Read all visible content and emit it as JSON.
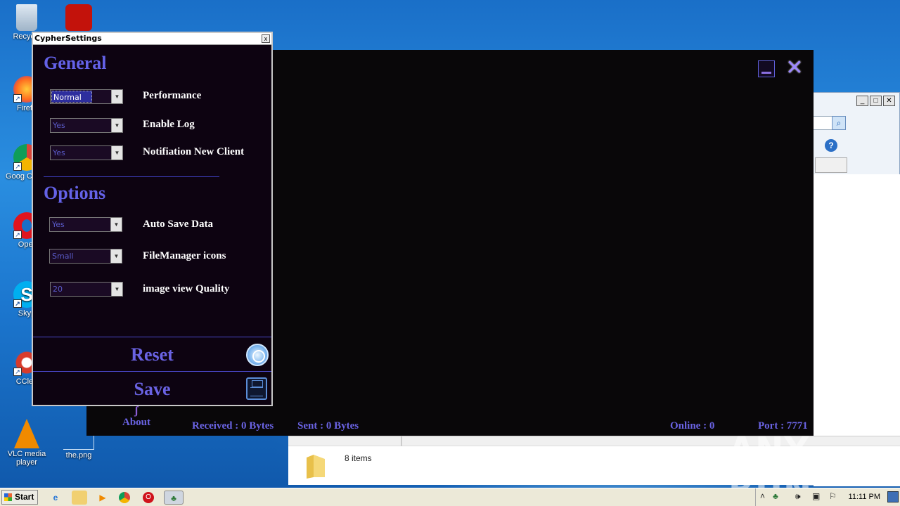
{
  "desktop": {
    "icons": [
      {
        "label": "Recycle"
      },
      {
        "label": "Firefo"
      },
      {
        "label": "Goog Chron"
      },
      {
        "label": "Oper"
      },
      {
        "label": "Skyp"
      },
      {
        "label": "CClea"
      },
      {
        "label": "VLC media player"
      },
      {
        "label": "the.png"
      }
    ]
  },
  "settings_window": {
    "title": "CypherSettings",
    "close_glyph": "x",
    "general": {
      "heading": "General",
      "rows": [
        {
          "label": "Performance",
          "value": "Normal"
        },
        {
          "label": "Enable Log",
          "value": "Yes"
        },
        {
          "label": "Notifiation New Client",
          "value": "Yes"
        }
      ]
    },
    "options": {
      "heading": "Options",
      "rows": [
        {
          "label": "Auto Save Data",
          "value": "Yes"
        },
        {
          "label": "FileManager icons",
          "value": "Small"
        },
        {
          "label": "image view Quality",
          "value": "20"
        }
      ]
    },
    "reset_label": "Reset",
    "save_label": "Save"
  },
  "main_app": {
    "about_label": "About",
    "received": "Received : 0 Bytes",
    "sent": "Sent : 0 Bytes",
    "online": "Online : 0",
    "port": "Port : 7771"
  },
  "explorer": {
    "status_items": "8 items"
  },
  "watermark": "ANY RUN",
  "taskbar": {
    "start_label": "Start",
    "clock": "11:11 PM"
  },
  "colors": {
    "accent": "#6a63e3",
    "window_bg": "#0d0311",
    "main_bg": "#090709"
  }
}
